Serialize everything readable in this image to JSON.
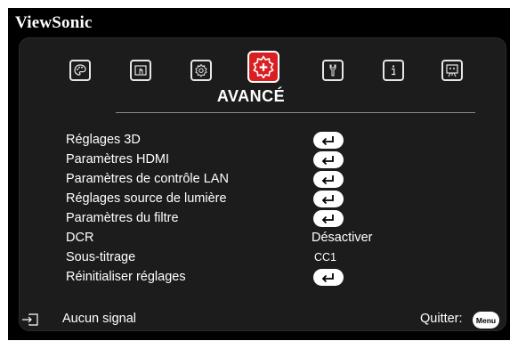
{
  "brand": "ViewSonic",
  "tabs": [
    {
      "name": "image-settings-tab",
      "icon": "palette-icon",
      "active": false
    },
    {
      "name": "screen-settings-tab",
      "icon": "screen-hand-icon",
      "active": false
    },
    {
      "name": "basic-tab",
      "icon": "gear-icon",
      "active": false
    },
    {
      "name": "advanced-tab",
      "icon": "gear-plus-icon",
      "active": true
    },
    {
      "name": "system-tab",
      "icon": "wrench-icon",
      "active": false
    },
    {
      "name": "information-tab",
      "icon": "info-icon",
      "active": false
    },
    {
      "name": "presentation-tab",
      "icon": "presentation-board-icon",
      "active": false
    }
  ],
  "section_title": "AVANCÉ",
  "menu_items": [
    {
      "label": "Réglages 3D",
      "value": "",
      "type": "enter"
    },
    {
      "label": "Paramètres HDMI",
      "value": "",
      "type": "enter"
    },
    {
      "label": "Paramètres de contrôle LAN",
      "value": "",
      "type": "enter"
    },
    {
      "label": "Réglages source de lumière",
      "value": "",
      "type": "enter"
    },
    {
      "label": "Paramètres du filtre",
      "value": "",
      "type": "enter"
    },
    {
      "label": "DCR",
      "value": "Désactiver",
      "type": "value"
    },
    {
      "label": "Sous-titrage",
      "value": "CC1",
      "type": "value"
    },
    {
      "label": "Réinitialiser réglages",
      "value": "",
      "type": "enter"
    }
  ],
  "footer": {
    "signal_text": "Aucun signal",
    "quit_label": "Quitter:",
    "menu_button": "Menu"
  },
  "colors": {
    "background": "#000000",
    "panel": "#1c1c1c",
    "active_tab": "#d91f22",
    "text": "#ffffff"
  }
}
